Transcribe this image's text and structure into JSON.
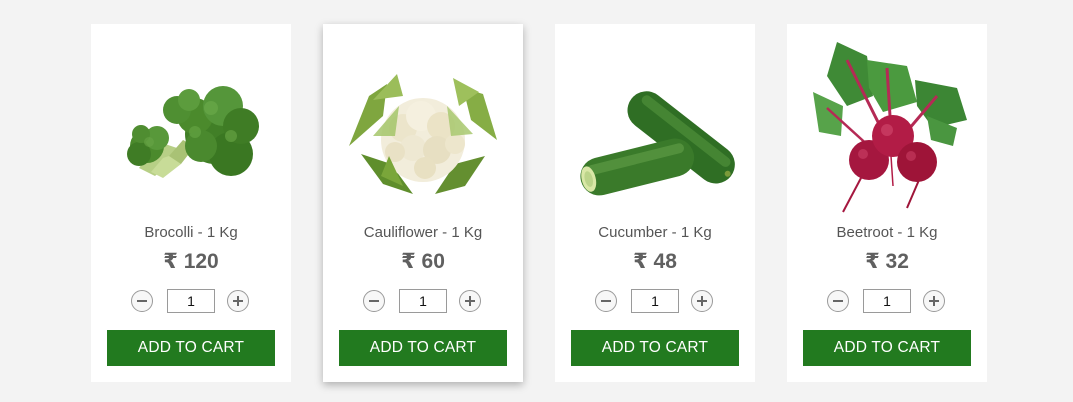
{
  "products": [
    {
      "name": "Brocolli - 1 Kg",
      "price": "₹ 120",
      "quantity": "1",
      "add_label": "ADD TO CART",
      "image": "broccoli-image"
    },
    {
      "name": "Cauliflower - 1 Kg",
      "price": "₹ 60",
      "quantity": "1",
      "add_label": "ADD TO CART",
      "image": "cauliflower-image"
    },
    {
      "name": "Cucumber - 1 Kg",
      "price": "₹ 48",
      "quantity": "1",
      "add_label": "ADD TO CART",
      "image": "cucumber-image"
    },
    {
      "name": "Beetroot - 1 Kg",
      "price": "₹ 32",
      "quantity": "1",
      "add_label": "ADD TO CART",
      "image": "beetroot-image"
    }
  ],
  "icons": {
    "decrement": "minus-icon",
    "increment": "plus-icon"
  },
  "colors": {
    "button_bg": "#227a1f",
    "button_text": "#ffffff",
    "page_bg": "#f3f3f3"
  }
}
